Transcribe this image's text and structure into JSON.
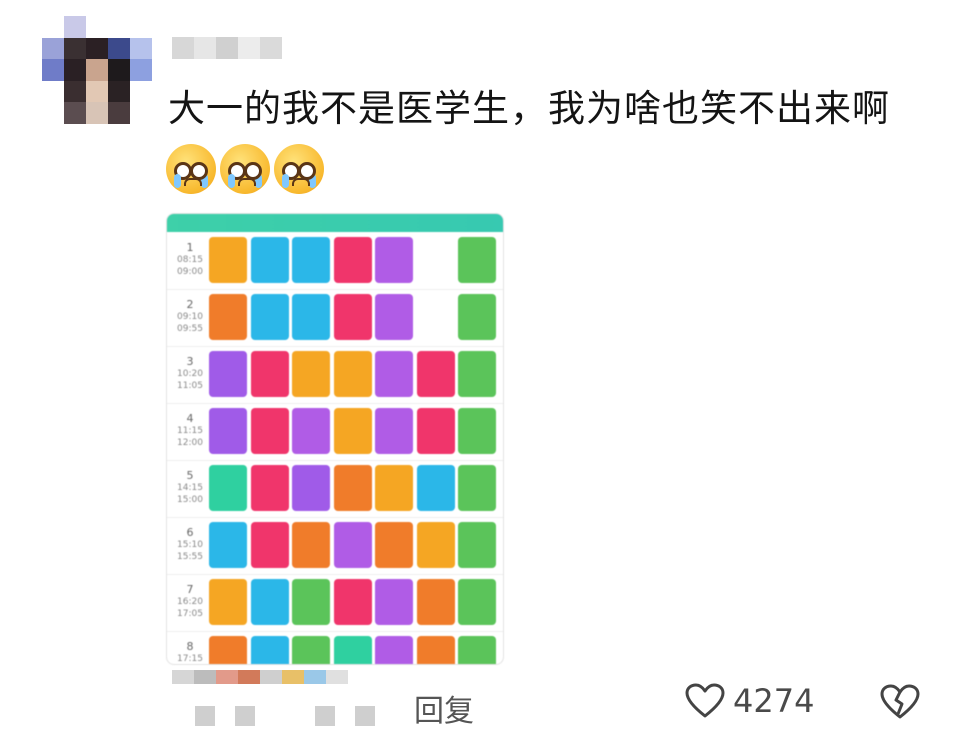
{
  "comment": {
    "text": "大一的我不是医学生，我为啥也笑不出来啊"
  },
  "actions": {
    "reply_label": "回复",
    "like_count": "4274"
  },
  "icons": {
    "like": "heart-outline-icon",
    "dislike": "broken-heart-icon"
  },
  "schedule": {
    "periods": [
      {
        "num": "1",
        "start": "08:15",
        "end": "09:00"
      },
      {
        "num": "2",
        "start": "09:10",
        "end": "09:55"
      },
      {
        "num": "3",
        "start": "10:20",
        "end": "11:05"
      },
      {
        "num": "4",
        "start": "11:15",
        "end": "12:00"
      },
      {
        "num": "5",
        "start": "14:15",
        "end": "15:00"
      },
      {
        "num": "6",
        "start": "15:10",
        "end": "15:55"
      },
      {
        "num": "7",
        "start": "16:20",
        "end": "17:05"
      },
      {
        "num": "8",
        "start": "17:15",
        "end": ""
      }
    ],
    "rows": [
      [
        {
          "day": 0,
          "color": "#f5a623"
        },
        {
          "day": 1,
          "color": "#2bb7e8"
        },
        {
          "day": 2,
          "color": "#2bb7e8"
        },
        {
          "day": 3,
          "color": "#f0356b"
        },
        {
          "day": 4,
          "color": "#b05ce6"
        },
        {
          "day": 6,
          "color": "#5bc45a"
        }
      ],
      [
        {
          "day": 0,
          "color": "#f07c2a"
        },
        {
          "day": 1,
          "color": "#2bb7e8"
        },
        {
          "day": 2,
          "color": "#2bb7e8"
        },
        {
          "day": 3,
          "color": "#f0356b"
        },
        {
          "day": 4,
          "color": "#b05ce6"
        },
        {
          "day": 6,
          "color": "#5bc45a"
        }
      ],
      [
        {
          "day": 0,
          "color": "#a05be8"
        },
        {
          "day": 1,
          "color": "#f0356b"
        },
        {
          "day": 2,
          "color": "#f5a623"
        },
        {
          "day": 3,
          "color": "#f5a623"
        },
        {
          "day": 4,
          "color": "#b05ce6"
        },
        {
          "day": 5,
          "color": "#f0356b"
        },
        {
          "day": 6,
          "color": "#5bc45a"
        }
      ],
      [
        {
          "day": 0,
          "color": "#a05be8"
        },
        {
          "day": 1,
          "color": "#f0356b"
        },
        {
          "day": 2,
          "color": "#b05ce6"
        },
        {
          "day": 3,
          "color": "#f5a623"
        },
        {
          "day": 4,
          "color": "#b05ce6"
        },
        {
          "day": 5,
          "color": "#f0356b"
        },
        {
          "day": 6,
          "color": "#5bc45a"
        }
      ],
      [
        {
          "day": 0,
          "color": "#2fd0a0"
        },
        {
          "day": 1,
          "color": "#f0356b"
        },
        {
          "day": 2,
          "color": "#a05be8"
        },
        {
          "day": 3,
          "color": "#f07c2a"
        },
        {
          "day": 4,
          "color": "#f5a623"
        },
        {
          "day": 5,
          "color": "#2bb7e8"
        },
        {
          "day": 6,
          "color": "#5bc45a"
        }
      ],
      [
        {
          "day": 0,
          "color": "#2bb7e8"
        },
        {
          "day": 1,
          "color": "#f0356b"
        },
        {
          "day": 2,
          "color": "#f07c2a"
        },
        {
          "day": 3,
          "color": "#b05ce6"
        },
        {
          "day": 4,
          "color": "#f07c2a"
        },
        {
          "day": 5,
          "color": "#f5a623"
        },
        {
          "day": 6,
          "color": "#5bc45a"
        }
      ],
      [
        {
          "day": 0,
          "color": "#f5a623"
        },
        {
          "day": 1,
          "color": "#2bb7e8"
        },
        {
          "day": 2,
          "color": "#5bc45a"
        },
        {
          "day": 3,
          "color": "#f0356b"
        },
        {
          "day": 4,
          "color": "#b05ce6"
        },
        {
          "day": 5,
          "color": "#f07c2a"
        },
        {
          "day": 6,
          "color": "#5bc45a"
        }
      ],
      [
        {
          "day": 0,
          "color": "#f07c2a"
        },
        {
          "day": 1,
          "color": "#2bb7e8"
        },
        {
          "day": 2,
          "color": "#5bc45a"
        },
        {
          "day": 3,
          "color": "#2fd0a0"
        },
        {
          "day": 4,
          "color": "#b05ce6"
        },
        {
          "day": 5,
          "color": "#f07c2a"
        },
        {
          "day": 6,
          "color": "#5bc45a"
        }
      ]
    ]
  }
}
